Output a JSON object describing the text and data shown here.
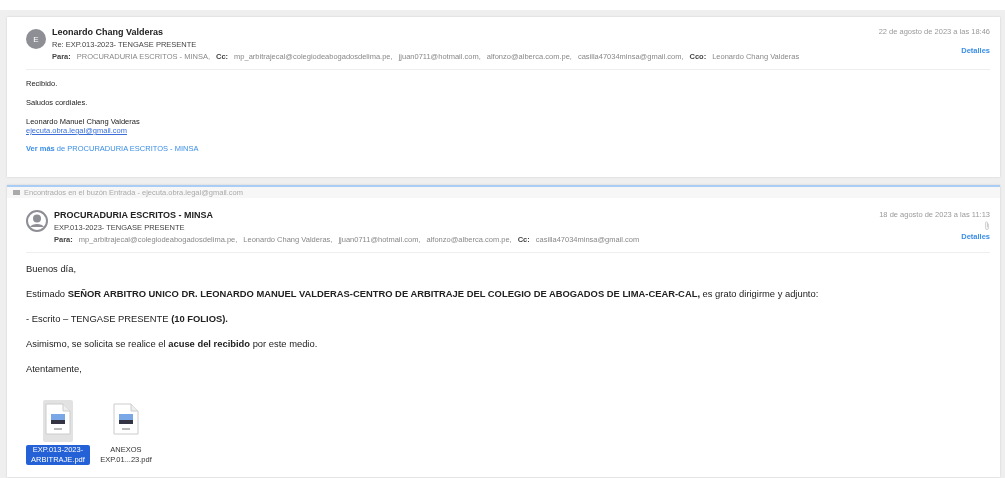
{
  "messages": [
    {
      "avatar": {
        "kind": "initial",
        "letter": "E"
      },
      "sender": "Leonardo Chang Valderas",
      "subject": "Re: EXP.013-2023- TENGASE PRESENTE",
      "date": "22 de agosto de 2023 a las 18:46",
      "details_link": "Detalles",
      "recipients": [
        {
          "label": "Para:",
          "addresses": [
            "PROCURADURIA ESCRITOS - MINSA,"
          ]
        },
        {
          "label": "Cc:",
          "addresses": [
            "mp_arbitrajecal@colegiodeabogadosdelima.pe,",
            "jjuan0711@hotmail.com,",
            "alfonzo@alberca.com.pe,",
            "casilla47034minsa@gmail.com,"
          ]
        },
        {
          "label": "Cco:",
          "addresses": [
            "Leonardo Chang Valderas"
          ]
        }
      ],
      "body": [
        {
          "kind": "text",
          "text": "Recibido."
        },
        {
          "kind": "text",
          "text": "Saludos cordiales."
        },
        {
          "kind": "signature",
          "text": "Leonardo Manuel Chang Valderas"
        },
        {
          "kind": "email",
          "text": "ejecuta.obra.legal@gmail.com"
        },
        {
          "kind": "more",
          "text": "**Ver más** de PROCURADURIA ESCRITOS - MINSA"
        }
      ]
    },
    {
      "found_in": "Encontrados en el buzón Entrada - ejecuta.obra.legal@gmail.com",
      "avatar": {
        "kind": "silhouette"
      },
      "sender": "PROCURADURIA ESCRITOS - MINSA",
      "subject": "EXP.013-2023- TENGASE PRESENTE",
      "date": "18 de agosto de 2023 a las 11:13",
      "has_attachment": true,
      "details_link": "Detalles",
      "recipients": [
        {
          "label": "Para:",
          "addresses": [
            "mp_arbitrajecal@colegiodeabogadosdelima.pe,",
            "Leonardo Chang Valderas,",
            "jjuan0711@hotmail.com,",
            "alfonzo@alberca.com.pe,"
          ]
        },
        {
          "label": "Cc:",
          "addresses": [
            "casilla47034minsa@gmail.com"
          ]
        }
      ],
      "body": [
        {
          "kind": "text",
          "text": "Buenos día,"
        },
        {
          "kind": "text",
          "text": "Estimado **SEÑOR ARBITRO UNICO DR. LEONARDO MANUEL VALDERAS-CENTRO DE ARBITRAJE DEL COLEGIO DE ABOGADOS DE LIMA-CEAR-CAL,** es grato dirigirme y adjunto:"
        },
        {
          "kind": "text",
          "text": "-  Escrito – TENGASE PRESENTE **(10 FOLIOS).**"
        },
        {
          "kind": "text",
          "text": "Asimismo, se solicita se realice el **acuse del recibido** por este medio."
        },
        {
          "kind": "text",
          "text": "Atentamente,"
        }
      ],
      "attachments": [
        {
          "name": "EXP.013-2023-ARBITRAJE.pdf",
          "selected": true
        },
        {
          "name": "ANEXOS EXP.01...23.pdf",
          "selected": false
        }
      ]
    }
  ]
}
